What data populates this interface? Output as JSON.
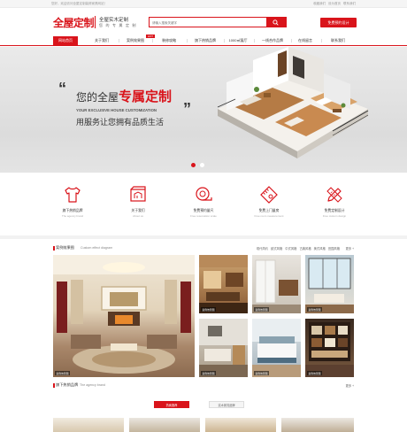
{
  "topbar": {
    "welcome": "您好，欢迎访问全屋定制装修家具网站！",
    "links": [
      "收藏我们",
      "设为首页",
      "联系我们"
    ]
  },
  "header": {
    "logo_text": "全屋定制",
    "slogan_line1": "全屋实木定制",
    "slogan_line2": "您 的 专 属 定 制",
    "search_placeholder": "请输入搜索关键字",
    "search_icon": "search-icon",
    "cta_label": "免费预约设计"
  },
  "nav": {
    "items": [
      "网站首页",
      "关于我们",
      "案例效果图",
      "装修攻略",
      "旗下热销品牌",
      "1000㎡展厅",
      "一线合作品牌",
      "在线留言",
      "联系我们"
    ],
    "active_index": 0,
    "badge": "HOT"
  },
  "banner": {
    "slogan_prefix": "您的全屋",
    "slogan_highlight": "专属定制",
    "slogan_en": "YOUR EXCLUSIVE HOUSE CUSTOMIZATION",
    "slogan_sub": "用服务让您拥有品质生活",
    "active_slide": 0,
    "slide_count": 2
  },
  "services": [
    {
      "icon": "shirt-icon",
      "title": "旗下热销品牌",
      "subtitle": "The agency brand"
    },
    {
      "icon": "blueprint-icon",
      "title": "关于我们",
      "subtitle": "About us"
    },
    {
      "icon": "measure-icon",
      "title": "免费预约量尺",
      "subtitle": "Free reservation scale"
    },
    {
      "icon": "diamond-ruler-icon",
      "title": "免费上门量房",
      "subtitle": "Free room measurement"
    },
    {
      "icon": "pencil-ruler-icon",
      "title": "免费定制设计",
      "subtitle": "Free custom design"
    }
  ],
  "cases": {
    "title": "案例效果图",
    "subtitle": "Custom effect diagram",
    "tabs": [
      "现代简约",
      "欧式风格",
      "中式风格",
      "古典风格",
      "美式风格",
      "田园风格"
    ],
    "more": "更多 +",
    "tiles": [
      "案例效果图",
      "案例效果图",
      "案例效果图",
      "案例效果图",
      "案例效果图",
      "案例效果图",
      "案例效果图"
    ]
  },
  "brands": {
    "title": "旗下热销品牌",
    "subtitle": "The agency brand",
    "more": "更多 +",
    "tabs": [
      "热卖推荐",
      "实木家具品牌"
    ],
    "active_tab": 0
  },
  "colors": {
    "accent": "#d9141b",
    "banner_bg": "#e2e2e2",
    "text": "#333333"
  }
}
